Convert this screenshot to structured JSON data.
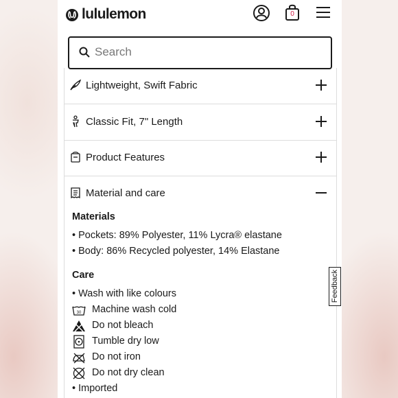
{
  "header": {
    "brand": "lululemon",
    "icons": [
      "logo-mark",
      "account-icon",
      "shopping-bag-icon",
      "menu-icon"
    ],
    "bag_count": "0",
    "bag_count_color": "#d31e47"
  },
  "search": {
    "placeholder": "Search"
  },
  "accordion": [
    {
      "label": "Lightweight, Swift Fabric",
      "icon": "feather-icon",
      "state": "collapsed"
    },
    {
      "label": "Classic Fit, 7\" Length",
      "icon": "fit-figure-icon",
      "state": "collapsed"
    },
    {
      "label": "Product Features",
      "icon": "features-icon",
      "state": "collapsed"
    },
    {
      "label": "Material and care",
      "icon": "care-label-icon",
      "state": "expanded"
    }
  ],
  "materials": {
    "title": "Materials",
    "items": [
      "• Pockets: 89% Polyester, 11% Lycra® elastane",
      "• Body: 86% Recycled polyester, 14% Elastane"
    ]
  },
  "care": {
    "title": "Care",
    "intro": "• Wash with like colours",
    "items": [
      {
        "text": "Machine wash cold",
        "icon": "wash-cold-icon"
      },
      {
        "text": "Do not bleach",
        "icon": "no-bleach-icon"
      },
      {
        "text": "Tumble dry low",
        "icon": "tumble-dry-low-icon"
      },
      {
        "text": "Do not iron",
        "icon": "no-iron-icon"
      },
      {
        "text": "Do not dry clean",
        "icon": "no-dry-clean-icon"
      }
    ],
    "origin": "• Imported"
  },
  "feedback_tab": {
    "label": "Feedback"
  }
}
